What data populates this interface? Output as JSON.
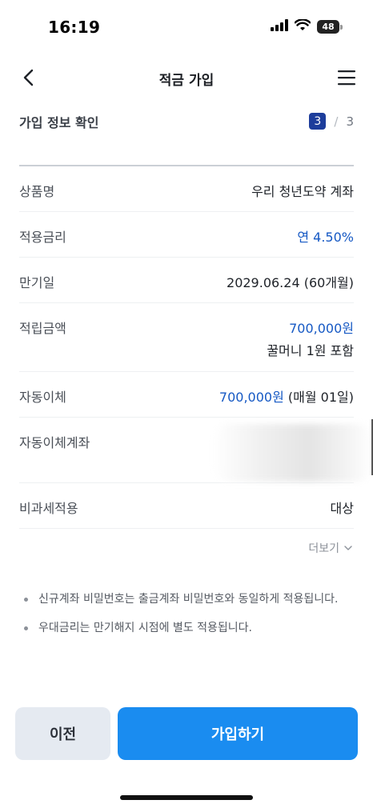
{
  "status_bar": {
    "time": "16:19",
    "battery": "48"
  },
  "nav": {
    "title": "적금 가입"
  },
  "step": {
    "title": "가입 정보 확인",
    "current": "3",
    "separator": "/",
    "total": "3"
  },
  "rows": [
    {
      "label": "상품명",
      "value": "우리 청년도약 계좌"
    },
    {
      "label": "적용금리",
      "value": "연 4.50%"
    },
    {
      "label": "만기일",
      "value": "2029.06.24 (60개월)"
    },
    {
      "label": "적립금액",
      "value": "700,000원",
      "sub_value": "꿀머니 1원 포함"
    },
    {
      "label": "자동이체",
      "value_amount": "700,000원",
      "value_suffix": " (매월 01일)"
    },
    {
      "label": "자동이체계좌",
      "value": ""
    },
    {
      "label": "비과세적용",
      "value": "대상"
    }
  ],
  "more_label": "더보기",
  "notes": [
    "신규계좌 비밀번호는 출금계좌 비밀번호와 동일하게 적용됩니다.",
    "우대금리는 만기해지 시점에 별도 적용됩니다."
  ],
  "buttons": {
    "prev": "이전",
    "join": "가입하기"
  },
  "colors": {
    "accent_blue": "#1a8cf0",
    "value_blue": "#1659c4",
    "step_badge": "#1d3d9b"
  }
}
